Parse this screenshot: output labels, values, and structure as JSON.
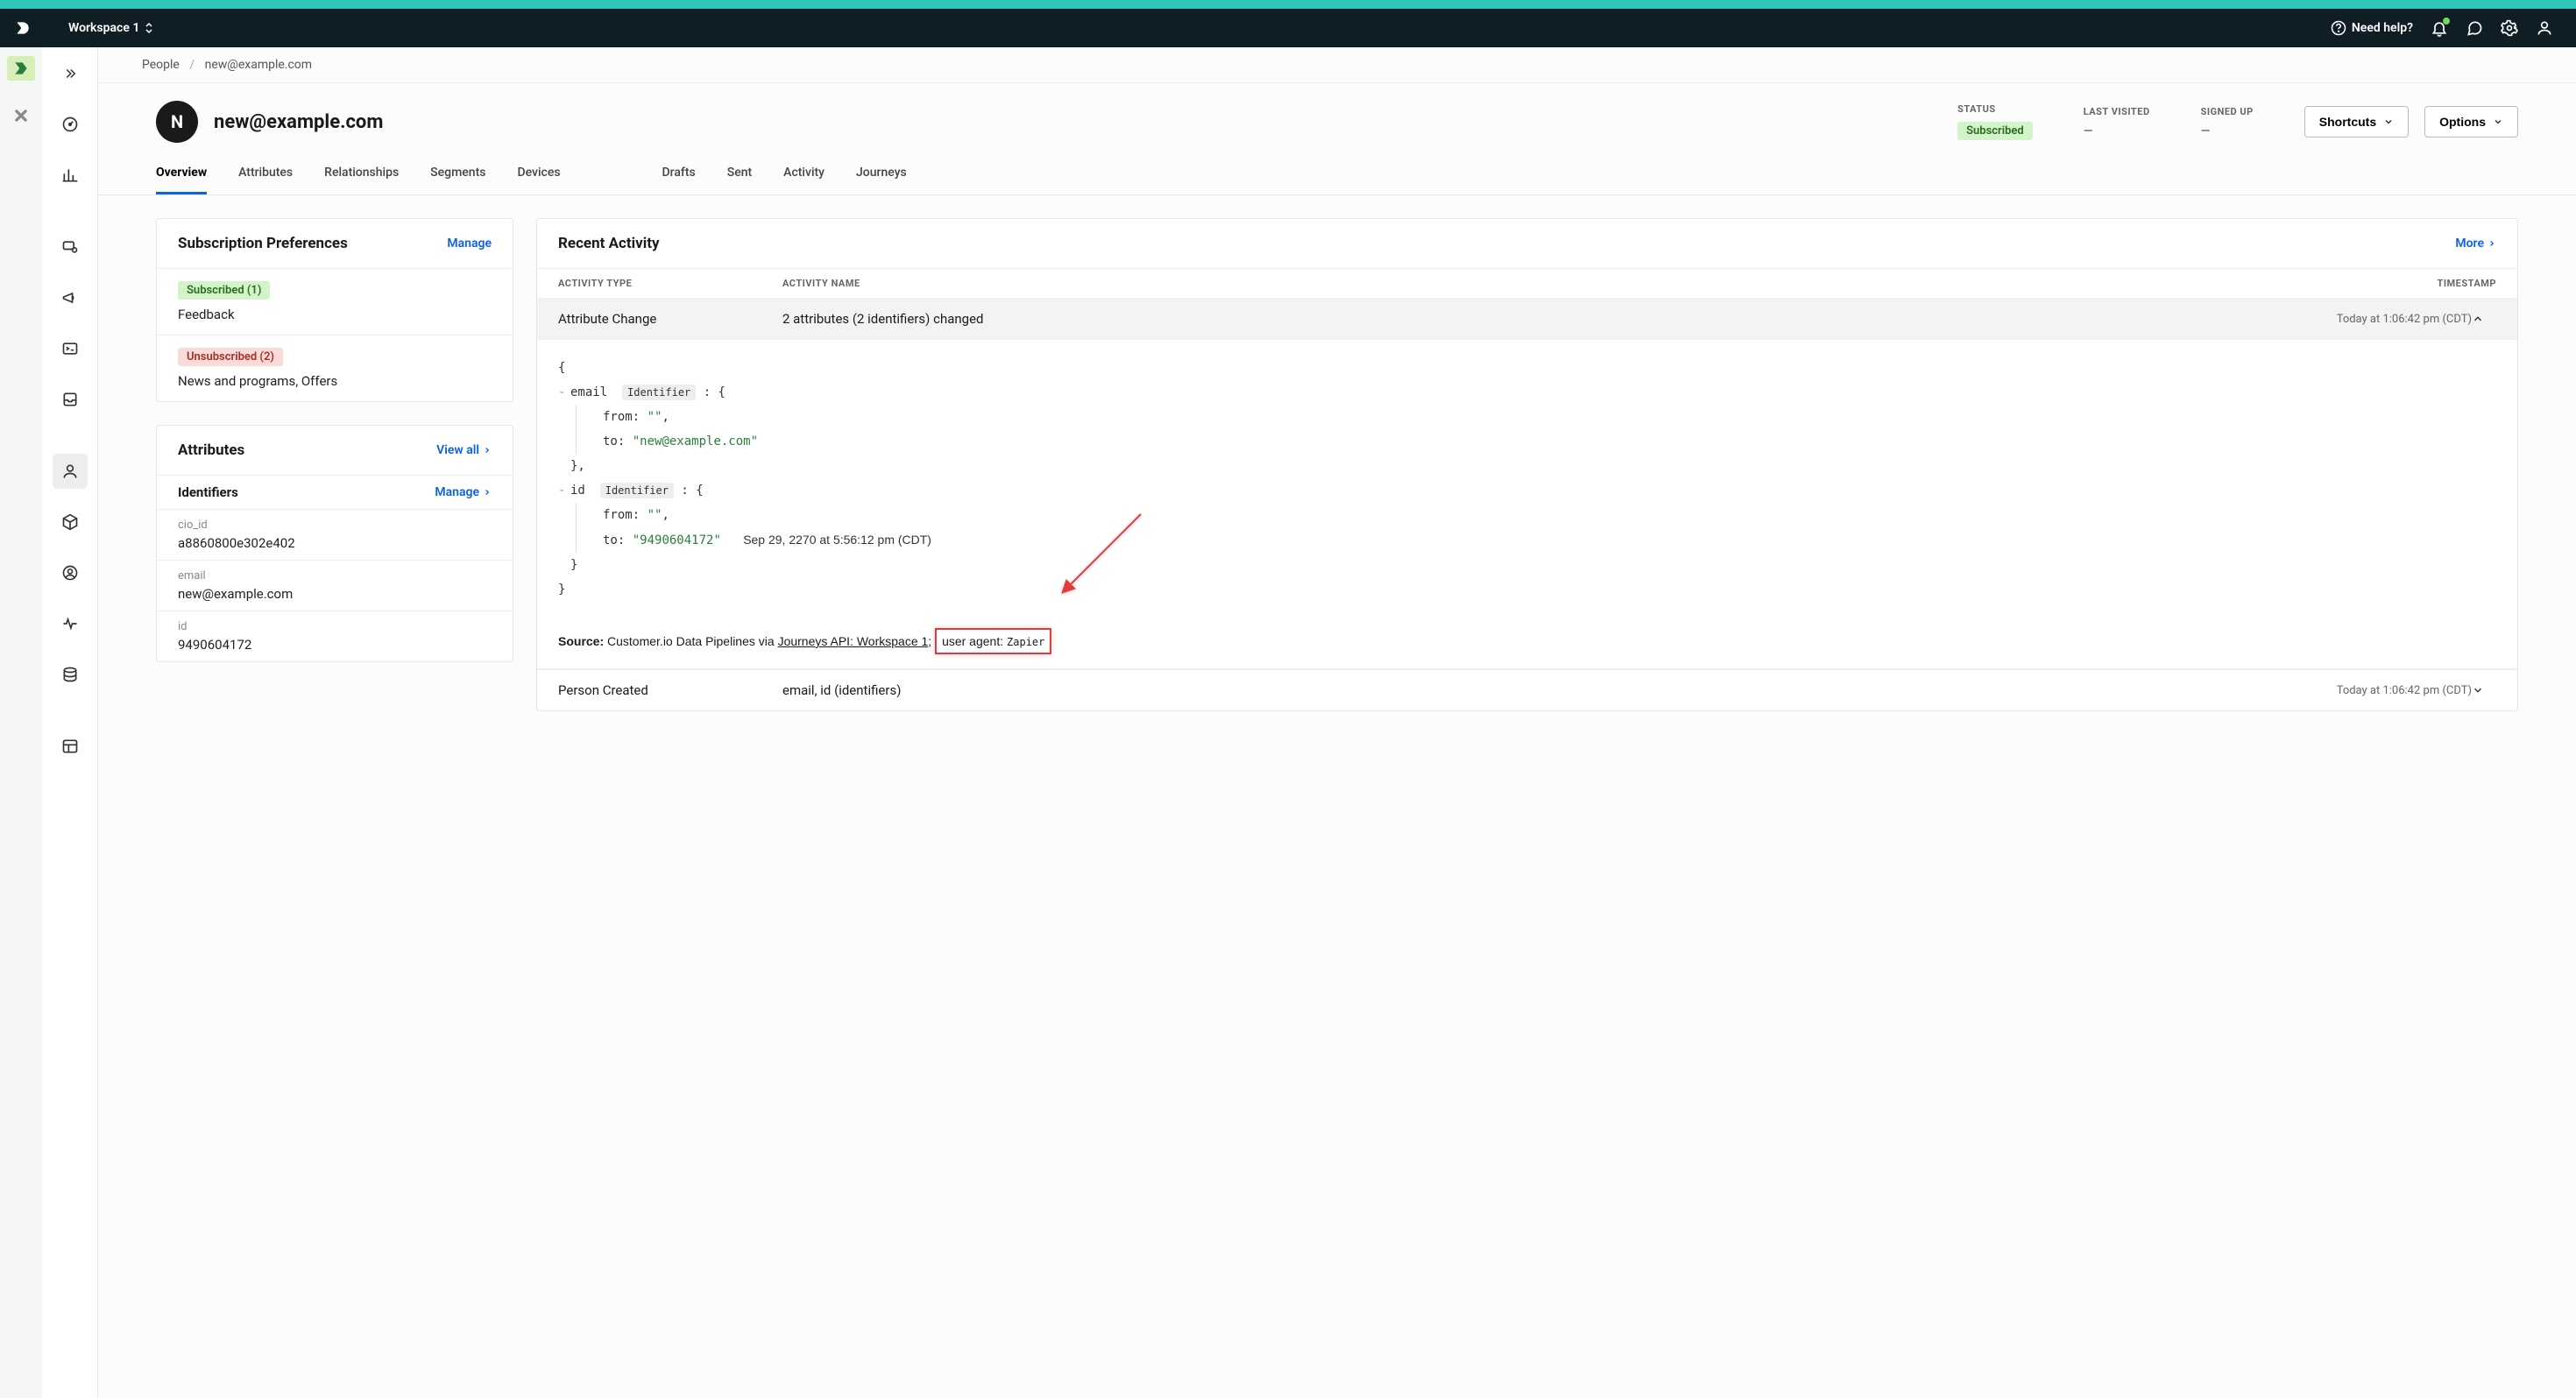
{
  "topbar": {
    "workspace": "Workspace 1",
    "help": "Need help?"
  },
  "breadcrumb": {
    "root": "People",
    "current": "new@example.com"
  },
  "profile": {
    "initial": "N",
    "email": "new@example.com",
    "status_label": "STATUS",
    "status_value": "Subscribed",
    "last_visited_label": "LAST VISITED",
    "last_visited_value": "—",
    "signed_up_label": "SIGNED UP",
    "signed_up_value": "—",
    "shortcuts_btn": "Shortcuts",
    "options_btn": "Options"
  },
  "tabs": {
    "overview": "Overview",
    "attributes": "Attributes",
    "relationships": "Relationships",
    "segments": "Segments",
    "devices": "Devices",
    "drafts": "Drafts",
    "sent": "Sent",
    "activity": "Activity",
    "journeys": "Journeys"
  },
  "subprefs": {
    "title": "Subscription Preferences",
    "manage": "Manage",
    "sub_pill": "Subscribed (1)",
    "sub_list": "Feedback",
    "unsub_pill": "Unsubscribed (2)",
    "unsub_list": "News and programs, Offers"
  },
  "attrs": {
    "title": "Attributes",
    "view_all": "View all",
    "identifiers_title": "Identifiers",
    "manage": "Manage",
    "rows": [
      {
        "k": "cio_id",
        "v": "a8860800e302e402"
      },
      {
        "k": "email",
        "v": "new@example.com"
      },
      {
        "k": "id",
        "v": "9490604172"
      }
    ]
  },
  "activity": {
    "title": "Recent Activity",
    "more": "More",
    "headers": {
      "type": "ACTIVITY TYPE",
      "name": "ACTIVITY NAME",
      "ts": "TIMESTAMP"
    },
    "row1": {
      "type": "Attribute Change",
      "name": "2 attributes (2 identifiers) changed",
      "ts": "Today at 1:06:42 pm (CDT)"
    },
    "json": {
      "email_label": "email",
      "identifier_tag": "Identifier",
      "from_label": "from:",
      "to_label": "to:",
      "email_from": "\"\"",
      "email_to": "\"new@example.com\"",
      "id_label": "id",
      "id_from": "\"\"",
      "id_to": "\"9490604172\"",
      "id_to_date": "Sep 29, 2270 at 5:56:12 pm (CDT)"
    },
    "source": {
      "label": "Source:",
      "text": "Customer.io Data Pipelines via ",
      "link": "Journeys API: Workspace 1",
      "agent_label": "user agent:",
      "agent_value": "Zapier"
    },
    "row2": {
      "type": "Person Created",
      "name": "email, id (identifiers)",
      "ts": "Today at 1:06:42 pm (CDT)"
    }
  }
}
